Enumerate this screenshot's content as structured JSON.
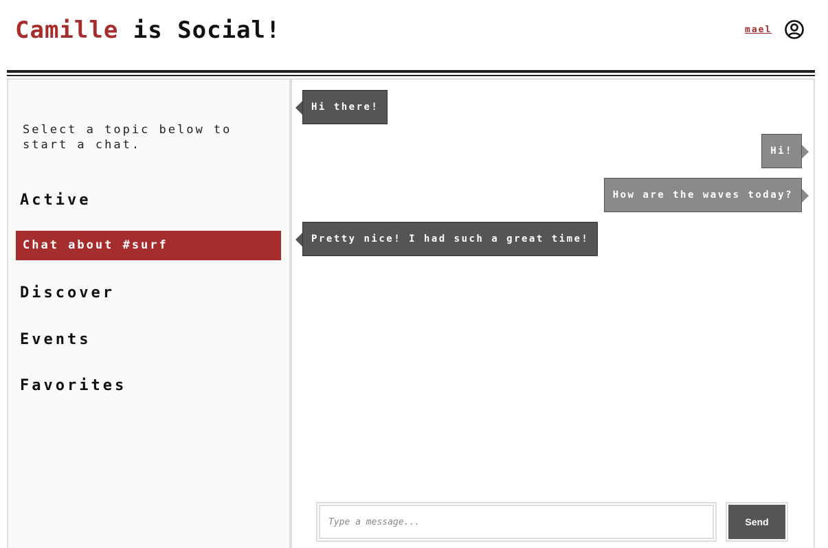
{
  "header": {
    "brand_name": "Camille",
    "brand_rest": " is Social!",
    "username": "mael",
    "avatar_icon": "user-circle-icon",
    "brand_color": "#a52d2d"
  },
  "sidebar": {
    "intro": "Select a topic below to start a chat.",
    "items": [
      {
        "label": "Active",
        "active": false
      },
      {
        "label": "Chat about #surf",
        "active": true
      },
      {
        "label": "Discover",
        "active": false
      },
      {
        "label": "Events",
        "active": false
      },
      {
        "label": "Favorites",
        "active": false
      }
    ]
  },
  "chat": {
    "messages": [
      {
        "text": "Hi there!",
        "direction": "incoming"
      },
      {
        "text": "Hi!",
        "direction": "outgoing"
      },
      {
        "text": "How are the waves today?",
        "direction": "outgoing"
      },
      {
        "text": "Pretty nice! I had such a great time!",
        "direction": "incoming"
      }
    ],
    "input_placeholder": "Type a message...",
    "send_label": "Send"
  }
}
